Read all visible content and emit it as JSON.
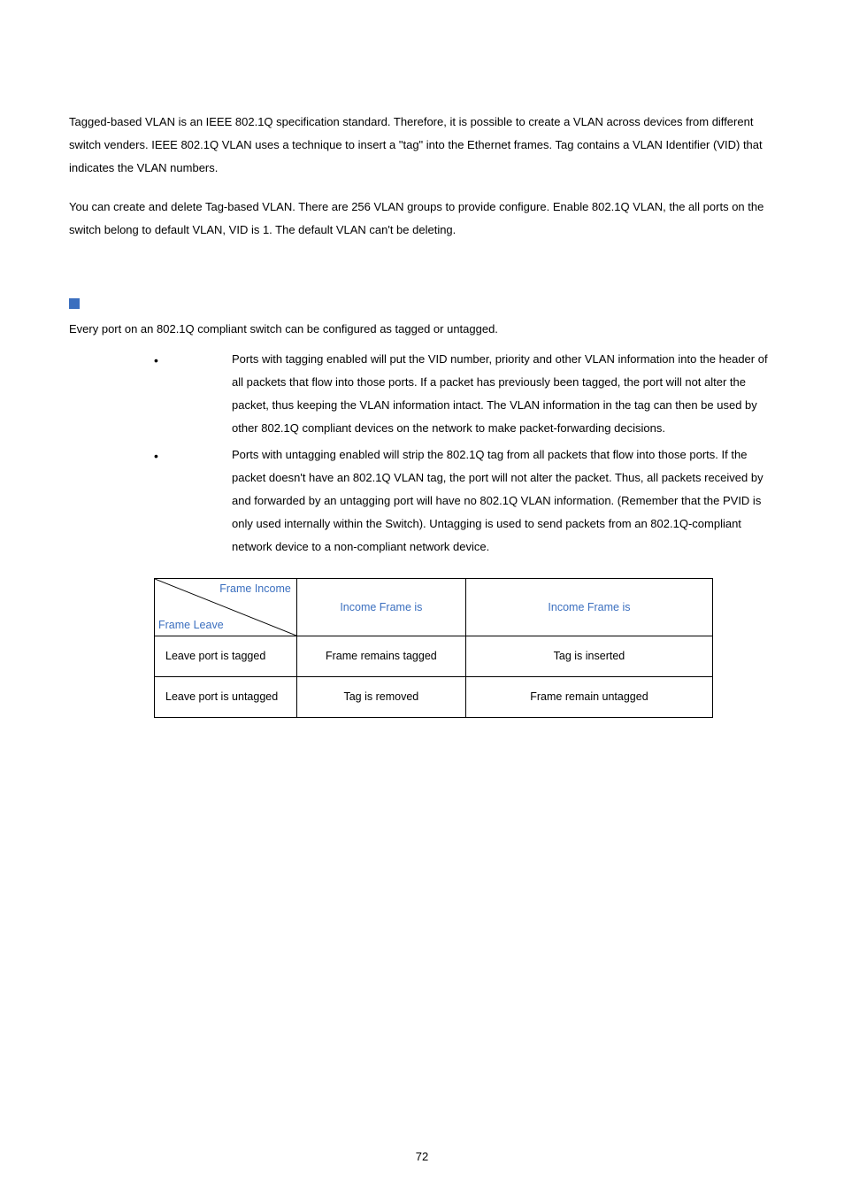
{
  "para1": "Tagged-based VLAN is an IEEE 802.1Q specification standard. Therefore, it is possible to create a VLAN across devices from different switch venders. IEEE 802.1Q VLAN uses a technique to insert a \"tag\" into the Ethernet frames. Tag contains a VLAN Identifier (VID) that indicates the VLAN numbers.",
  "para2": "You can create and delete Tag-based VLAN. There are 256 VLAN groups to provide configure. Enable 802.1Q VLAN, the all ports on the switch belong to default VLAN, VID is 1. The default VLAN can't be deleting.",
  "intro": "Every port on an 802.1Q compliant switch can be configured as tagged or untagged.",
  "bullet1": "Ports with tagging enabled will put the VID number, priority and other VLAN information into the header of all packets that flow into those ports. If a packet has previously been tagged, the port will not alter the packet, thus keeping the VLAN information intact. The VLAN information in the tag can then be used by other 802.1Q compliant devices on the network to make packet-forwarding decisions.",
  "bullet2": "Ports with untagging enabled will strip the 802.1Q tag from all packets that flow into those ports. If the packet doesn't have an 802.1Q VLAN tag, the port will not alter the packet. Thus, all packets received by and forwarded by an untagging port will have no 802.1Q VLAN information. (Remember that the PVID is only used internally within the Switch). Untagging is used to send packets from an 802.1Q-compliant network device to a non-compliant network device.",
  "table": {
    "diag_top": "Frame Income",
    "diag_bot": "Frame Leave",
    "h2": "Income Frame is",
    "h3": "Income Frame is",
    "r1c1": "Leave port is tagged",
    "r1c2": "Frame remains tagged",
    "r1c3": "Tag is inserted",
    "r2c1": "Leave port is untagged",
    "r2c2": "Tag is removed",
    "r2c3": "Frame remain untagged"
  },
  "pagenum": "72"
}
